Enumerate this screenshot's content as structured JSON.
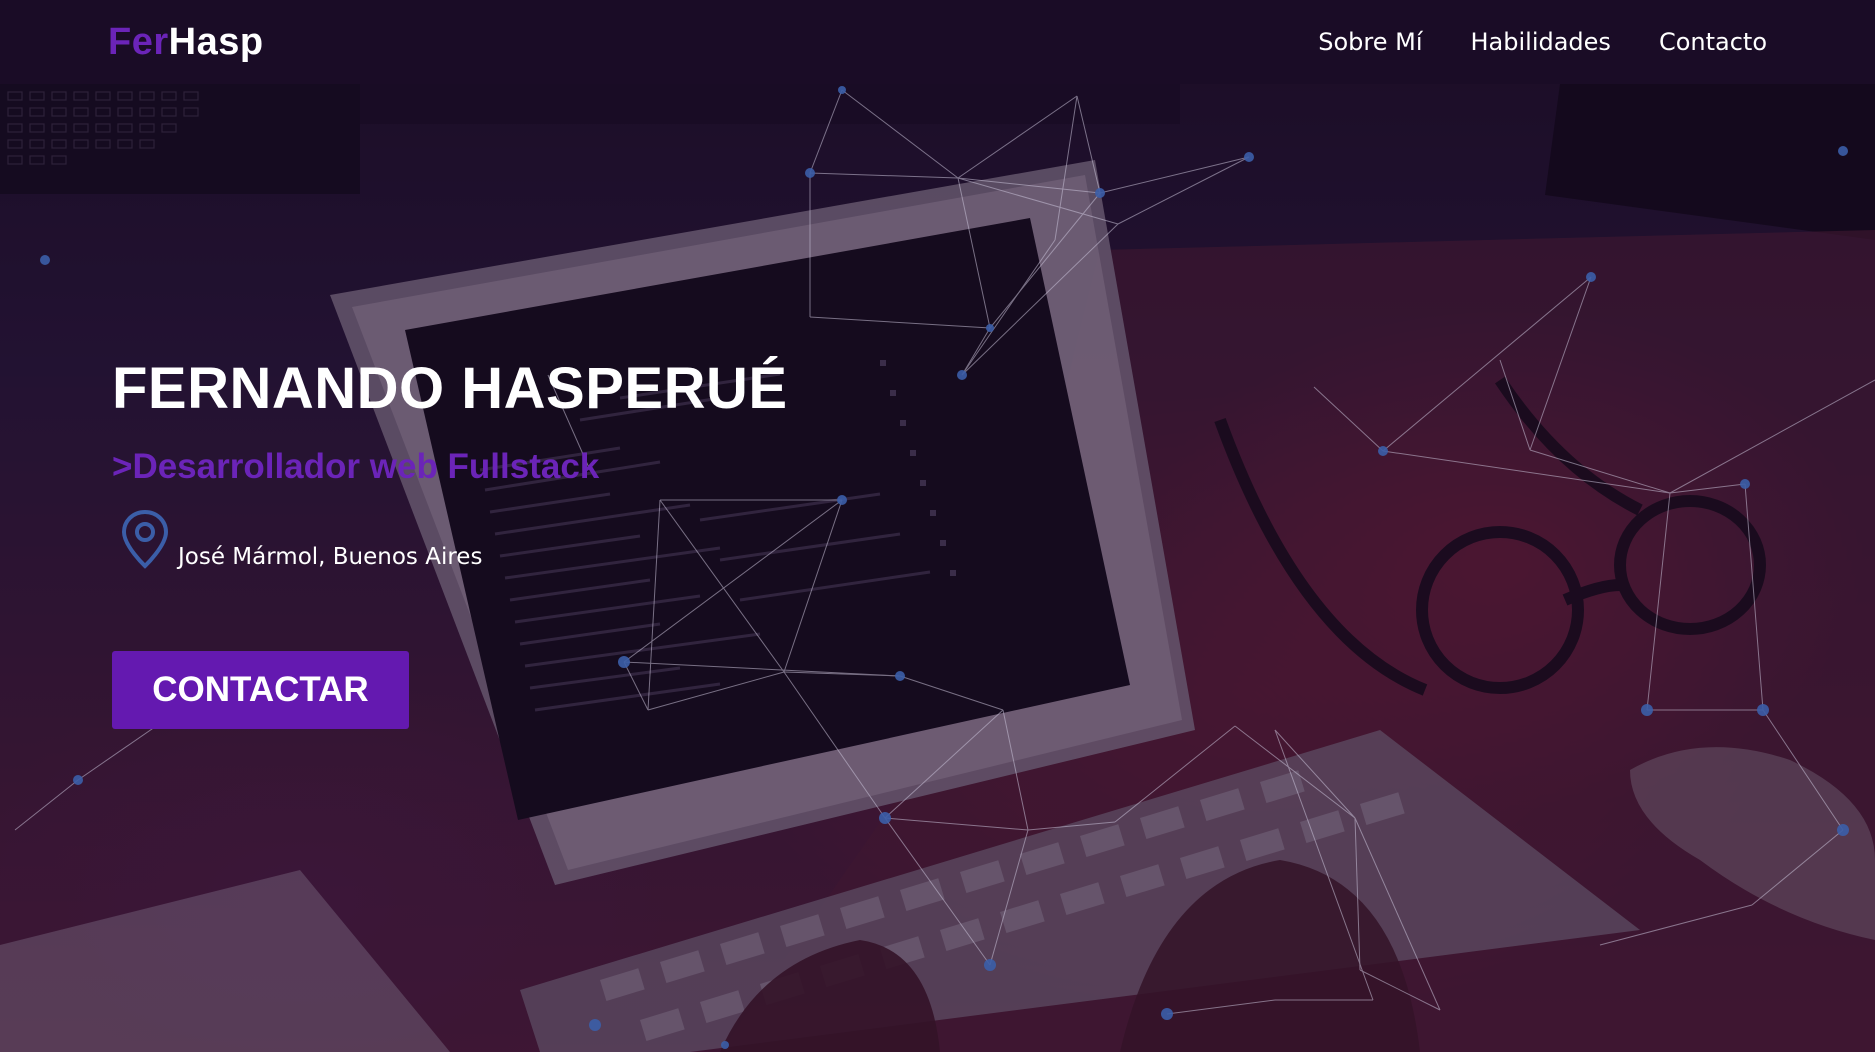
{
  "navbar": {
    "brand_part1": "Fer",
    "brand_part2": "Hasp",
    "links": [
      {
        "label": "Sobre Mí"
      },
      {
        "label": "Habilidades"
      },
      {
        "label": "Contacto"
      }
    ]
  },
  "hero": {
    "name": "FERNANDO HASPERUÉ",
    "subtitle": ">Desarrollador web Fullstack",
    "location_icon": "map-pin-icon",
    "location": "José Mármol, Buenos Aires",
    "cta_label": "CONTACTAR"
  },
  "colors": {
    "accent": "#6b24b8",
    "button": "#6419b0",
    "navbar_bg": "#1a0c26",
    "text": "#ffffff"
  }
}
